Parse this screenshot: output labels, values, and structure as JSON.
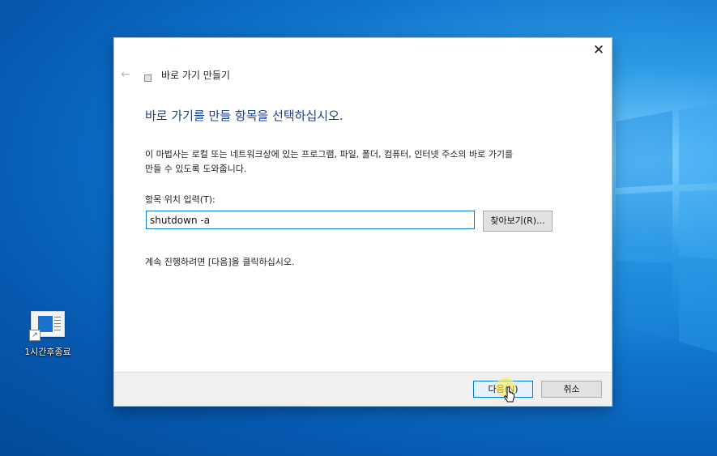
{
  "desktop": {
    "icon_label": "1시간후종료"
  },
  "dialog": {
    "title": "바로 가기 만들기",
    "heading": "바로 가기를 만들 항목을 선택하십시오.",
    "description_line1": "이 마법사는 로컬 또는 네트워크상에 있는 프로그램, 파일, 폴더, 컴퓨터, 인터넷 주소의 바로 가기를",
    "description_line2": "만들 수 있도록 도와줍니다.",
    "input_label": "항목 위치 입력(T):",
    "input_value": "shutdown -a",
    "browse_label": "찾아보기(R)...",
    "continue_text": "계속 진행하려면 [다음]을 클릭하십시오.",
    "next_label": "다음(N)",
    "cancel_label": "취소",
    "close_glyph": "✕",
    "back_glyph": "←"
  },
  "colors": {
    "accent": "#0078d7",
    "heading": "#1d3f8c",
    "desktop": "#0b6fc4"
  }
}
